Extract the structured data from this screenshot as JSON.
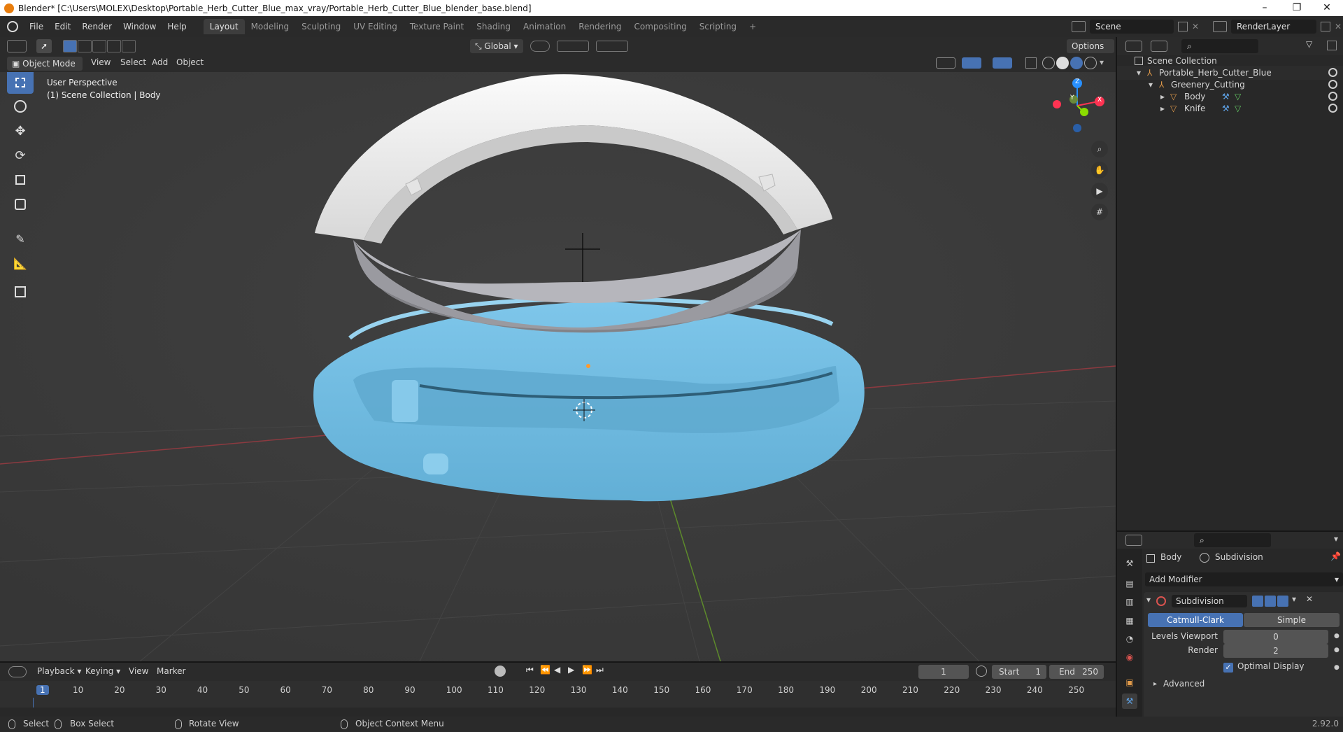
{
  "window": {
    "title": "Blender* [C:\\Users\\MOLEX\\Desktop\\Portable_Herb_Cutter_Blue_max_vray/Portable_Herb_Cutter_Blue_blender_base.blend]",
    "minimize": "–",
    "restore": "❐",
    "close": "✕"
  },
  "menu": [
    "File",
    "Edit",
    "Render",
    "Window",
    "Help"
  ],
  "workspaces": [
    "Layout",
    "Modeling",
    "Sculpting",
    "UV Editing",
    "Texture Paint",
    "Shading",
    "Animation",
    "Rendering",
    "Compositing",
    "Scripting"
  ],
  "workspace_add": "+",
  "scene": {
    "label": "Scene",
    "value": "Scene"
  },
  "render_layer": {
    "value": "RenderLayer"
  },
  "viewport_header": {
    "transform_orientation": "Global",
    "options": "Options",
    "mode": "Object Mode",
    "menus": [
      "View",
      "Select",
      "Add",
      "Object"
    ]
  },
  "viewport": {
    "perspective": "User Perspective",
    "collection_info": "(1) Scene Collection | Body",
    "gizmo": {
      "x": "X",
      "y": "Y",
      "z": "Z"
    }
  },
  "outliner": {
    "items": [
      {
        "label": "Scene Collection",
        "level": 0
      },
      {
        "label": "Portable_Herb_Cutter_Blue",
        "level": 1
      },
      {
        "label": "Greenery_Cutting",
        "level": 2
      },
      {
        "label": "Body",
        "level": 3
      },
      {
        "label": "Knife",
        "level": 3
      }
    ]
  },
  "properties": {
    "object_name": "Body",
    "modifier_name_header": "Subdivision",
    "add_modifier": "Add Modifier",
    "modifier": {
      "name": "Subdivision",
      "type_options": [
        "Catmull-Clark",
        "Simple"
      ],
      "selected_type": "Catmull-Clark",
      "levels_viewport_label": "Levels Viewport",
      "levels_viewport": "0",
      "render_label": "Render",
      "render": "2",
      "optimal_display_label": "Optimal Display",
      "optimal_display": true,
      "advanced": "Advanced"
    }
  },
  "timeline": {
    "menus": [
      "Playback",
      "Keying",
      "View",
      "Marker"
    ],
    "current_frame": "1",
    "start_label": "Start",
    "start": "1",
    "end_label": "End",
    "end": "250",
    "ticks": [
      "1",
      "10",
      "20",
      "30",
      "40",
      "50",
      "60",
      "70",
      "80",
      "90",
      "100",
      "110",
      "120",
      "130",
      "140",
      "150",
      "160",
      "170",
      "180",
      "190",
      "200",
      "210",
      "220",
      "230",
      "240",
      "250"
    ]
  },
  "statusbar": {
    "select": "Select",
    "box_select": "Box Select",
    "rotate_view": "Rotate View",
    "context_menu": "Object Context Menu",
    "version": "2.92.0"
  },
  "colors": {
    "accent": "#4772b3",
    "body_mesh": "#74bfe4",
    "knife_top": "#f1f1f1",
    "knife_ring": "#8a8a8e",
    "viewport_bg": "#3b3b3b",
    "x_axis": "#ff3352",
    "y_axis": "#8bdc00",
    "z_axis": "#2890ff"
  }
}
